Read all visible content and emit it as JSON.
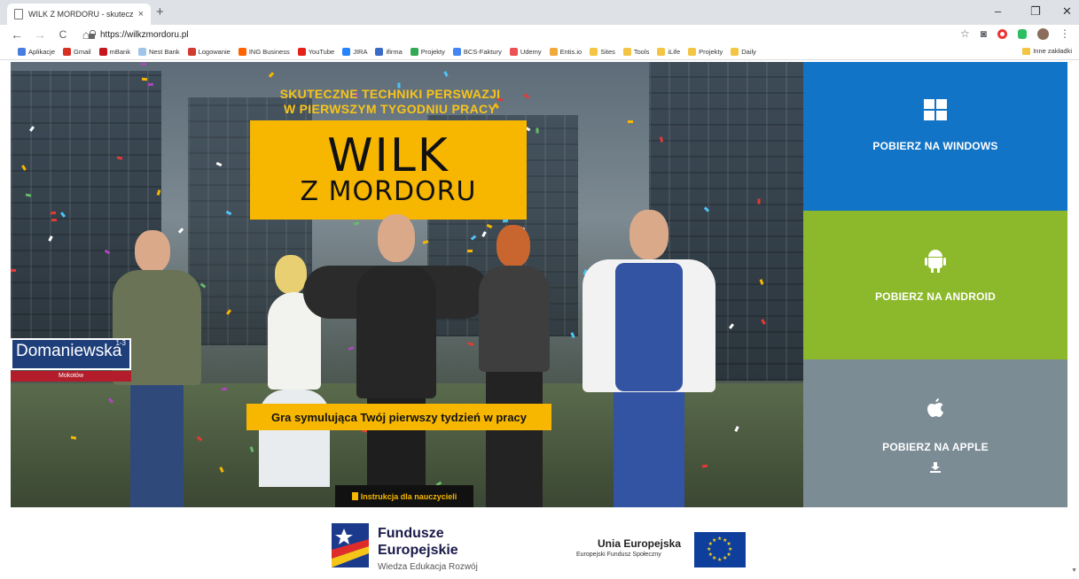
{
  "browser": {
    "tab_title": "WILK Z MORDORU - skuteczne t",
    "tab_close": "×",
    "new_tab": "+",
    "window_controls": [
      "–",
      "❐",
      "✕"
    ],
    "url": "https://wilkzmordoru.pl",
    "nav": {
      "back": "←",
      "forward": "→",
      "reload": "C",
      "home": "⌂"
    },
    "bookmarks": [
      {
        "label": "Aplikacje",
        "color": "#4a7de0"
      },
      {
        "label": "Gmail",
        "color": "#d93025"
      },
      {
        "label": "mBank",
        "color": "#c4161c"
      },
      {
        "label": "Nest Bank",
        "color": "#9fc5e8"
      },
      {
        "label": "Logowanie",
        "color": "#d23b2f"
      },
      {
        "label": "ING Business",
        "color": "#ff6200"
      },
      {
        "label": "YouTube",
        "color": "#e62117"
      },
      {
        "label": "JIRA",
        "color": "#2684ff"
      },
      {
        "label": "ifirma",
        "color": "#3a6bc7"
      },
      {
        "label": "Projekty",
        "color": "#34a853"
      },
      {
        "label": "BCS-Faktury",
        "color": "#4285f4"
      },
      {
        "label": "Udemy",
        "color": "#ec5252"
      },
      {
        "label": "Entis.io",
        "color": "#f0a93b"
      },
      {
        "label": "Sites",
        "color": "#f4c542"
      },
      {
        "label": "Tools",
        "color": "#f4c542"
      },
      {
        "label": "iLife",
        "color": "#f4c542"
      },
      {
        "label": "Projekty",
        "color": "#f4c542"
      },
      {
        "label": "Daily",
        "color": "#f4c542"
      }
    ],
    "other_bookmarks": "Inne zakładki"
  },
  "hero": {
    "tagline_line1": "SKUTECZNE TECHNIKI PERSWAZJI",
    "tagline_line2": "W PIERWSZYM TYGODNIU PRACY",
    "logo_line1": "WILK",
    "logo_line2": "Z MORDORU",
    "subtitle": "Gra symulująca Twój pierwszy tydzień w pracy",
    "teacher_button": "Instrukcja dla nauczycieli",
    "street_sign": {
      "name": "Domaniewska",
      "number": "1-3",
      "district": "Mokotów"
    }
  },
  "downloads": [
    {
      "label": "POBIERZ NA WINDOWS",
      "color": "#1274c6"
    },
    {
      "label": "POBIERZ NA ANDROID",
      "color": "#8cb82b"
    },
    {
      "label": "POBIERZ NA APPLE",
      "color": "#7c8c95"
    }
  ],
  "footer": {
    "fe_title_line1": "Fundusze",
    "fe_title_line2": "Europejskie",
    "fe_subtitle": "Wiedza Edukacja Rozwój",
    "ue_title": "Unia Europejska",
    "ue_subtitle": "Europejski Fundusz Społeczny"
  },
  "colors": {
    "accent_yellow": "#f7b700",
    "tagline_yellow": "#f8c31a"
  }
}
